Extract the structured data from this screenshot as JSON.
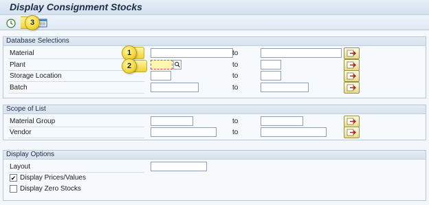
{
  "window": {
    "title": "Display Consignment Stocks"
  },
  "toolbar": {
    "execute_icon": "execute-clock-icon",
    "variant_icon": "get-variant-icon"
  },
  "callouts": [
    "1",
    "2",
    "3"
  ],
  "groups": {
    "database_selections": {
      "title": "Database Selections",
      "rows": [
        {
          "label": "Material",
          "to": "to",
          "low": "",
          "high": ""
        },
        {
          "label": "Plant",
          "to": "to",
          "low": "",
          "high": ""
        },
        {
          "label": "Storage Location",
          "to": "to",
          "low": "",
          "high": ""
        },
        {
          "label": "Batch",
          "to": "to",
          "low": "",
          "high": ""
        }
      ]
    },
    "scope_of_list": {
      "title": "Scope of List",
      "rows": [
        {
          "label": "Material Group",
          "to": "to",
          "low": "",
          "high": ""
        },
        {
          "label": "Vendor",
          "to": "to",
          "low": "",
          "high": ""
        }
      ]
    },
    "display_options": {
      "title": "Display Options",
      "layout_label": "Layout",
      "layout_value": "",
      "display_prices_label": "Display Prices/Values",
      "display_prices_checked": true,
      "display_zero_label": "Display Zero Stocks",
      "display_zero_checked": false
    }
  },
  "colors": {
    "background": "#f4f8fc",
    "callout": "#f1d73c",
    "required_field": "#fff6b0",
    "multi_select_button": "#e9dc8c"
  }
}
